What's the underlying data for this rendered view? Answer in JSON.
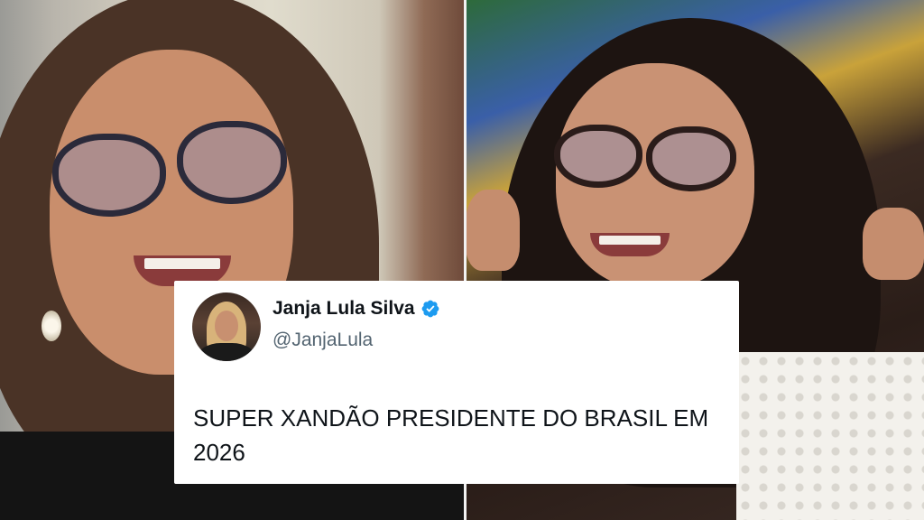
{
  "tweet": {
    "display_name": "Janja Lula Silva",
    "handle": "@JanjaLula",
    "text": "SUPER XANDÃO PRESIDENTE DO BRASIL EM 2026",
    "verified": true,
    "verified_color": "#1d9bf0"
  },
  "photos": {
    "left": {
      "description_icon": "portrait-photo"
    },
    "right": {
      "description_icon": "portrait-photo"
    }
  },
  "colors": {
    "card_bg": "#ffffff",
    "name_color": "#0f1419",
    "handle_color": "#536471"
  }
}
